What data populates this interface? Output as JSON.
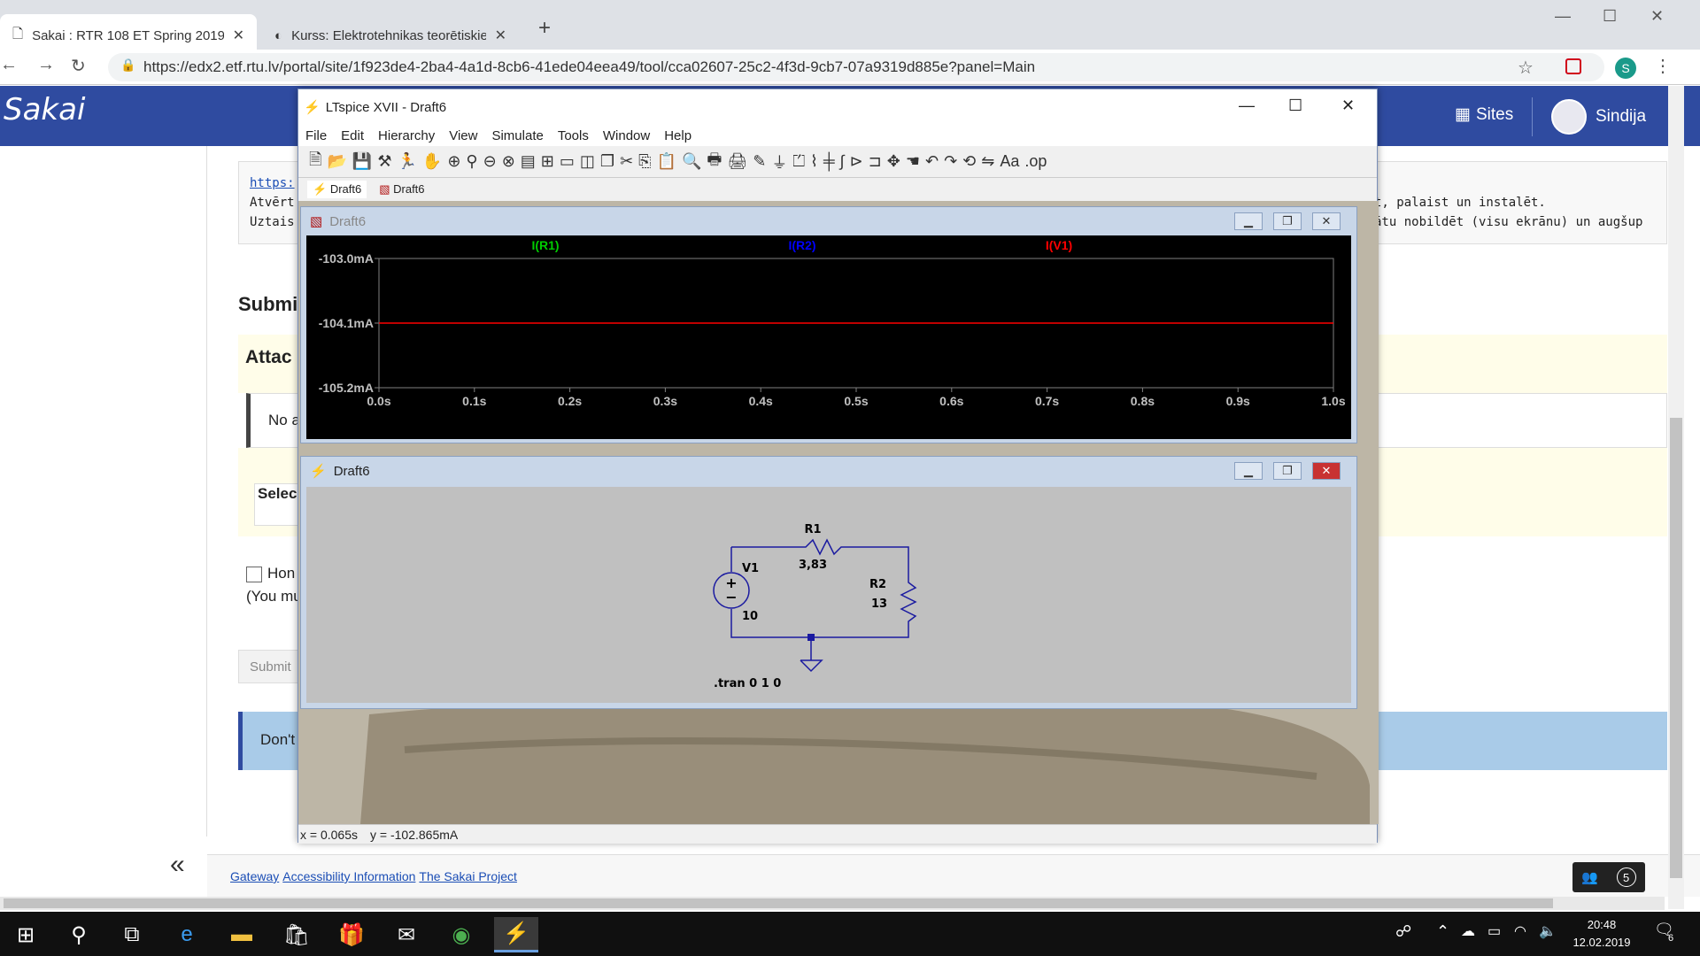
{
  "browser": {
    "tabs": [
      {
        "title": "Sakai : RTR 108 ET Spring 2019 : ",
        "active": true
      },
      {
        "title": "Kurss: Elektrotehnikas teorētiskie",
        "active": false
      }
    ],
    "url": "https://edx2.etf.rtu.lv/portal/site/1f923de4-2ba4-41ade04eea49/tool/cca02607-25c2-4f3d-9cb7-07a9319d885e?panel=Main",
    "url_display": "https://edx2.etf.rtu.lv/portal/site/1f923de4-2ba4-4a1d-8cb6-41ede04eea49/tool/cca02607-25c2-4f3d-9cb7-07a9319d885e?panel=Main",
    "profile_initial": "S"
  },
  "sakai": {
    "logo": "Sakai",
    "sites_label": "Sites",
    "user_name": "Sindija",
    "info_link": "https:",
    "info_line1_left": "Atvērt",
    "info_line1_right": "t, palaist un instalēt.",
    "info_line2_left": "Uztais",
    "info_line2_right": "ātu nobildēt (visu ekrānu) un augšup",
    "submit_heading": "Submi",
    "attach_heading": "Attac",
    "no_attach": "No a",
    "select_label": "Selec",
    "honor_label": "Hon",
    "must_label": "(You mu",
    "submit_button": "Submit",
    "dont_label": "Don't",
    "collapse_label": "«",
    "footer_links": [
      "Gateway",
      "Accessibility Information",
      "The Sakai Project"
    ],
    "chat_count": "5"
  },
  "ltspice": {
    "title": "LTspice XVII - Draft6",
    "menu": [
      "File",
      "Edit",
      "Hierarchy",
      "View",
      "Simulate",
      "Tools",
      "Window",
      "Help"
    ],
    "doc_tabs": [
      "Draft6",
      "Draft6"
    ],
    "plot_window_title": "Draft6",
    "schematic_window_title": "Draft6",
    "status_x": "x = 0.065s",
    "status_y": "y = -102.865mA",
    "schematic": {
      "r1_name": "R1",
      "r1_value": "3,83",
      "r2_name": "R2",
      "r2_value": "13",
      "v1_name": "V1",
      "v1_value": "10",
      "directive": ".tran 0 1 0"
    },
    "colors": {
      "r1": "#00cc00",
      "r2": "#0000ff",
      "v1": "#ff0000"
    }
  },
  "chart_data": {
    "type": "line",
    "legend": [
      "I(R1)",
      "I(R2)",
      "I(V1)"
    ],
    "x_ticks": [
      "0.0s",
      "0.1s",
      "0.2s",
      "0.3s",
      "0.4s",
      "0.5s",
      "0.6s",
      "0.7s",
      "0.8s",
      "0.9s",
      "1.0s"
    ],
    "y_ticks": [
      "-103.0mA",
      "-104.1mA",
      "-105.2mA"
    ],
    "xlim": [
      0,
      1
    ],
    "ylim": [
      -105.2,
      -103.0
    ],
    "series": [
      {
        "name": "I(V1)",
        "x": [
          0,
          1
        ],
        "y": [
          -104.1,
          -104.1
        ]
      }
    ]
  },
  "taskbar": {
    "time": "20:48",
    "date": "12.02.2019",
    "notif_count": "6"
  }
}
